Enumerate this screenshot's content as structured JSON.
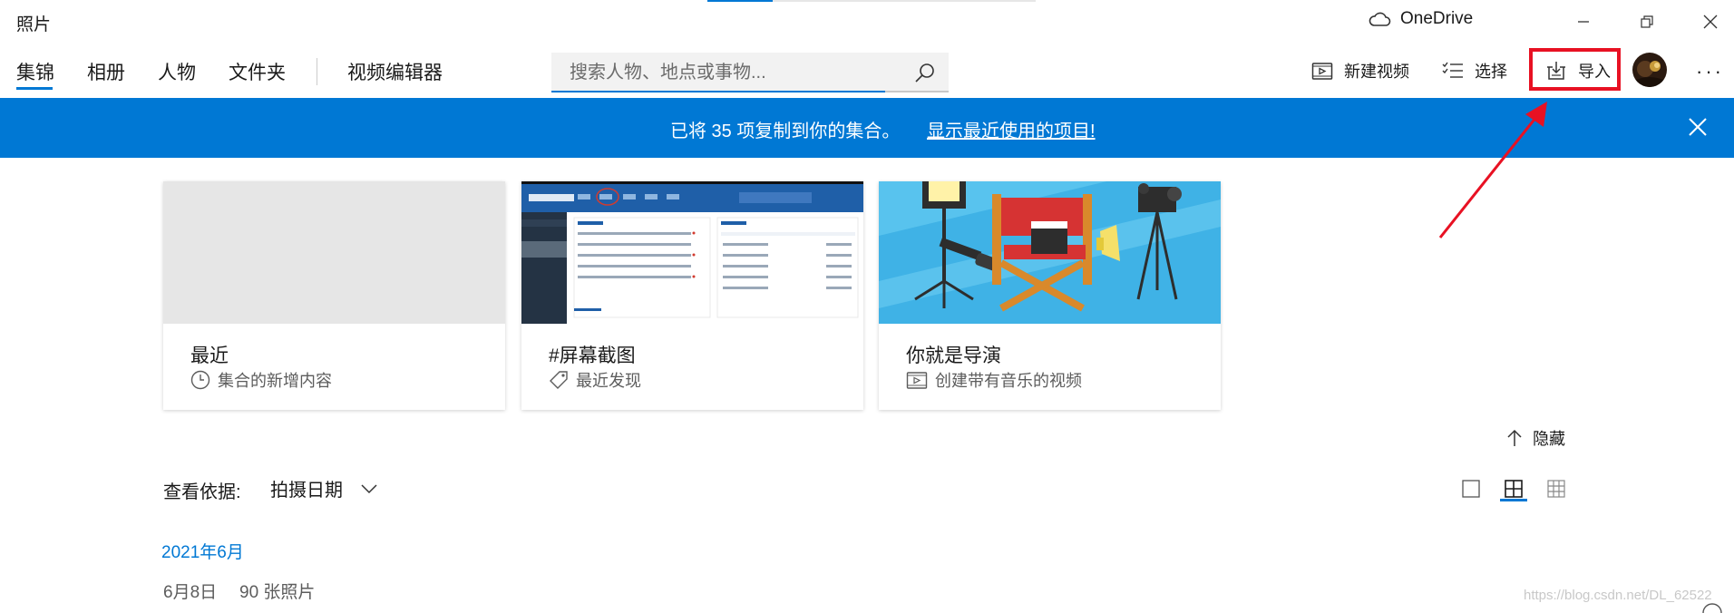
{
  "app": {
    "title": "照片",
    "onedrive_label": "OneDrive",
    "loading_progress": 0.2
  },
  "nav": {
    "tabs": [
      {
        "label": "集锦",
        "selected": true
      },
      {
        "label": "相册"
      },
      {
        "label": "人物"
      },
      {
        "label": "文件夹"
      },
      {
        "label": "视频编辑器"
      }
    ]
  },
  "search": {
    "placeholder": "搜索人物、地点或事物...",
    "value": ""
  },
  "toolbar": {
    "new_video_label": "新建视频",
    "select_label": "选择",
    "import_label": "导入",
    "more_label": "···"
  },
  "banner": {
    "message": "已将 35 项复制到你的集合。",
    "link": "显示最近使用的项目!",
    "color": "#0078d4"
  },
  "cards": [
    {
      "title": "最近",
      "subtitle": "集合的新增内容",
      "icon": "clock-icon"
    },
    {
      "title": "#屏幕截图",
      "subtitle": "最近发现",
      "icon": "tag-icon"
    },
    {
      "title": "你就是导演",
      "subtitle": "创建带有音乐的视频",
      "icon": "video-icon"
    }
  ],
  "hide_label": "隐藏",
  "view": {
    "label": "查看依据:",
    "value": "拍摄日期",
    "sizes": [
      "large-tile",
      "medium-tile",
      "small-tile"
    ],
    "selected_size": "medium-tile"
  },
  "groups": [
    {
      "month": "2021年6月",
      "day": "6月8日",
      "count": "90 张照片"
    }
  ],
  "watermark": "https://blog.csdn.net/DL_62522",
  "colors": {
    "accent": "#0078d4",
    "highlight": "#e81123"
  }
}
